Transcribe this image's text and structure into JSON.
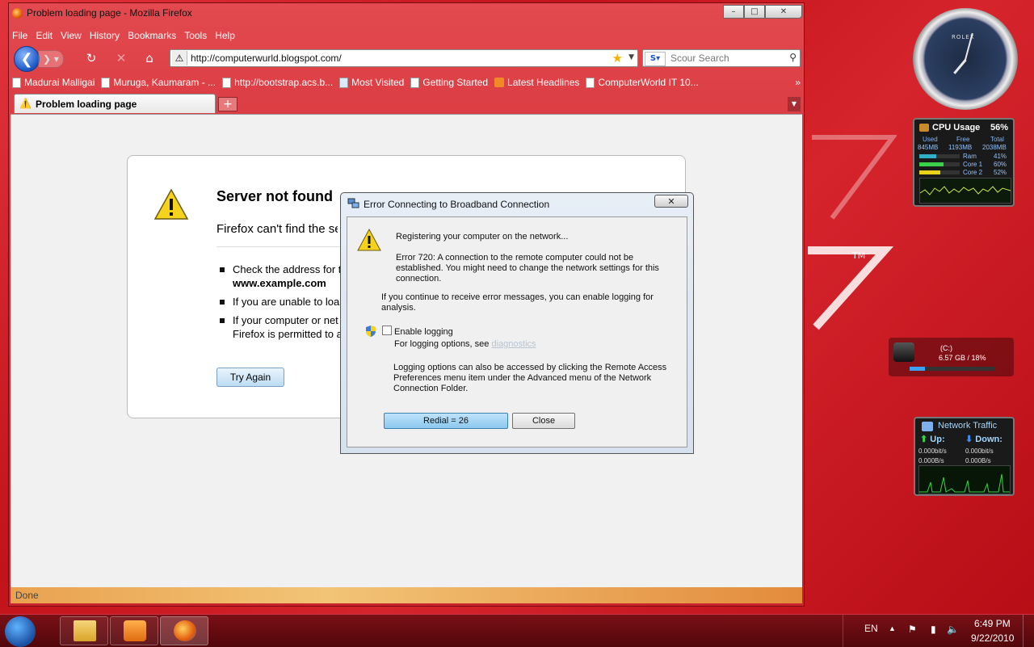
{
  "firefox": {
    "window_title": "Problem loading page - Mozilla Firefox",
    "menu": [
      "File",
      "Edit",
      "View",
      "History",
      "Bookmarks",
      "Tools",
      "Help"
    ],
    "url": "http://computerwurld.blogspot.com/",
    "search_placeholder": "Scour Search",
    "bookmarks": [
      {
        "label": "Madurai Malligai",
        "icon": "page"
      },
      {
        "label": "Muruga, Kaumaram - ...",
        "icon": "page"
      },
      {
        "label": "http://bootstrap.acs.b...",
        "icon": "page"
      },
      {
        "label": "Most Visited",
        "icon": "search"
      },
      {
        "label": "Getting Started",
        "icon": "page"
      },
      {
        "label": "Latest Headlines",
        "icon": "rss"
      },
      {
        "label": "ComputerWorld IT 10...",
        "icon": "page"
      }
    ],
    "bookmarks_overflow": "»",
    "tab_label": "Problem loading page",
    "new_tab_label": "+",
    "error": {
      "title": "Server not found",
      "subtitle": "Firefox can't find the se",
      "bullets": [
        "Check the address for t",
        "www.example.com",
        "If you are unable to loa",
        "If your computer or net",
        "Firefox is permitted to a"
      ],
      "try_again": "Try Again"
    },
    "status": "Done"
  },
  "dialog": {
    "title": "Error Connecting to Broadband Connection",
    "close_label": "✕",
    "registering": "Registering your computer on the network...",
    "error_text": "Error 720: A connection to the remote computer could not be established.  You might need to change the network settings for this connection.",
    "continue_text": "If you continue to receive error messages, you can enable logging for analysis.",
    "enable_logging": "Enable logging",
    "logging_options": "For logging options, see",
    "diagnostics_link": "diagnostics",
    "logging_info": "Logging options can also be accessed by clicking the Remote Access Preferences menu item under the Advanced menu of the Network Connection Folder.",
    "redial_label": "Redial = 26",
    "close_button": "Close"
  },
  "gadgets": {
    "clock_brand": "ROLEX",
    "cpu": {
      "title": "CPU Usage",
      "percent": "56%",
      "used_label": "Used",
      "free_label": "Free",
      "total_label": "Total",
      "used": "845MB",
      "free": "1193MB",
      "total": "2038MB",
      "rows": [
        {
          "label": "Ram",
          "value": "41%",
          "fill": 0.41,
          "color": "#2fb0c8"
        },
        {
          "label": "Core 1",
          "value": "60%",
          "fill": 0.6,
          "color": "#3bd04a"
        },
        {
          "label": "Core 2",
          "value": "52%",
          "fill": 0.52,
          "color": "#e8d21a"
        }
      ]
    },
    "drive": {
      "label": "(C:)",
      "value": "6.57 GB / 18%",
      "fill": 0.18
    },
    "network": {
      "title": "Network Traffic",
      "up_label": "Up:",
      "down_label": "Down:",
      "up_bits": "0.000bit/s",
      "down_bits": "0.000bit/s",
      "up_bytes": "0.000B/s",
      "down_bytes": "0.000B/s"
    }
  },
  "desktop": {
    "tm": "TM"
  },
  "taskbar": {
    "lang": "EN",
    "time": "6:49 PM",
    "date": "9/22/2010"
  }
}
